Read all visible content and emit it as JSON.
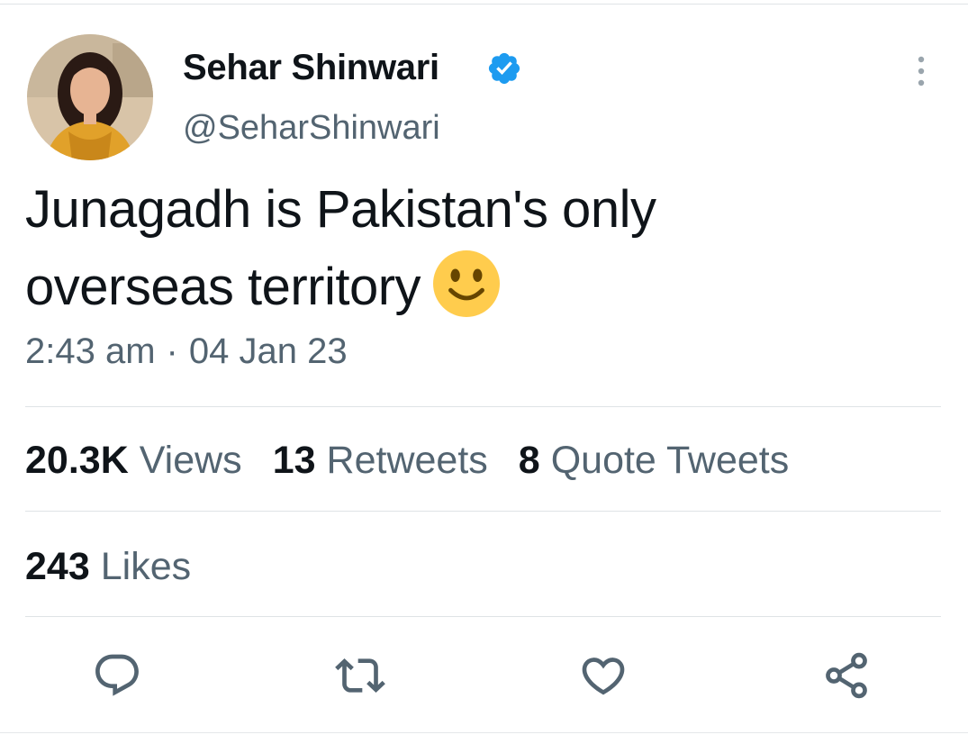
{
  "tweet": {
    "author": {
      "display_name": "Sehar Shinwari",
      "handle": "@SeharShinwari",
      "verified": true,
      "verified_icon": "verified-badge-icon"
    },
    "text": "Junagadh is Pakistan's only overseas territory",
    "emoji": "slightly-smiling-face",
    "time": "2:43 am",
    "separator": "·",
    "date": "04 Jan 23",
    "stats": {
      "views_count": "20.3K",
      "views_label": "Views",
      "retweets_count": "13",
      "retweets_label": "Retweets",
      "quotes_count": "8",
      "quotes_label": "Quote Tweets",
      "likes_count": "243",
      "likes_label": "Likes"
    },
    "actions": [
      "reply-icon",
      "retweet-icon",
      "like-icon",
      "share-icon"
    ]
  },
  "colors": {
    "primary_text": "#0f1419",
    "secondary_text": "#536471",
    "verified_blue": "#1d9bf0",
    "divider": "#dfe3e6",
    "emoji_yellow": "#ffcc4d"
  }
}
